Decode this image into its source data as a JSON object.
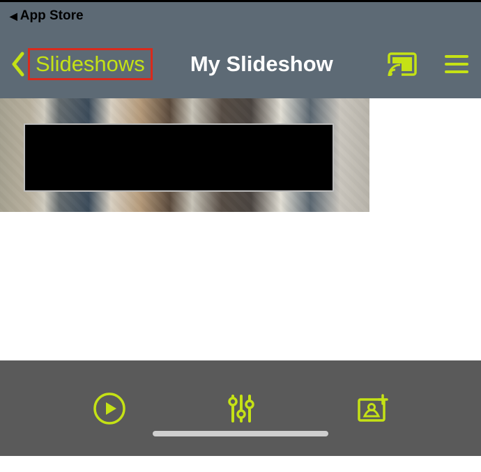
{
  "status": {
    "app_store_label": "App Store"
  },
  "nav": {
    "back_label": "Slideshows",
    "title": "My Slideshow"
  },
  "accent_color": "#c5e215",
  "highlight_color": "#d92a1c",
  "icons": {
    "back_chevron": "chevron-left",
    "cast": "cast",
    "menu": "hamburger",
    "play": "play-circle",
    "settings": "sliders",
    "add_photo": "add-image"
  }
}
